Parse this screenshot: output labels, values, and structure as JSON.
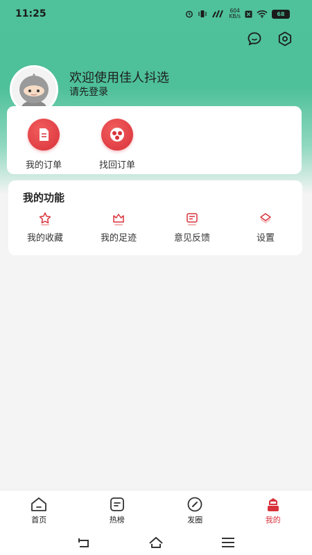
{
  "status_bar": {
    "time": "11:25",
    "speed_value": "604",
    "speed_unit": "KB/s",
    "battery": "68"
  },
  "profile": {
    "welcome": "欢迎使用佳人抖选",
    "login_hint": "请先登录"
  },
  "orders": {
    "items": [
      {
        "label": "我的订单",
        "icon": "order-icon"
      },
      {
        "label": "找回订单",
        "icon": "retrieve-order-icon"
      }
    ]
  },
  "functions": {
    "title": "我的功能",
    "items": [
      {
        "label": "我的收藏",
        "icon": "star-icon"
      },
      {
        "label": "我的足迹",
        "icon": "crown-icon"
      },
      {
        "label": "意见反馈",
        "icon": "feedback-icon"
      },
      {
        "label": "设置",
        "icon": "settings-icon"
      }
    ]
  },
  "bottom_nav": {
    "items": [
      {
        "label": "首页",
        "icon": "home-icon"
      },
      {
        "label": "热榜",
        "icon": "hot-list-icon"
      },
      {
        "label": "发圈",
        "icon": "post-icon"
      },
      {
        "label": "我的",
        "icon": "me-icon"
      }
    ],
    "active": "我的"
  },
  "colors": {
    "header_green": "#4fc19b",
    "accent_red": "#d8323a"
  }
}
